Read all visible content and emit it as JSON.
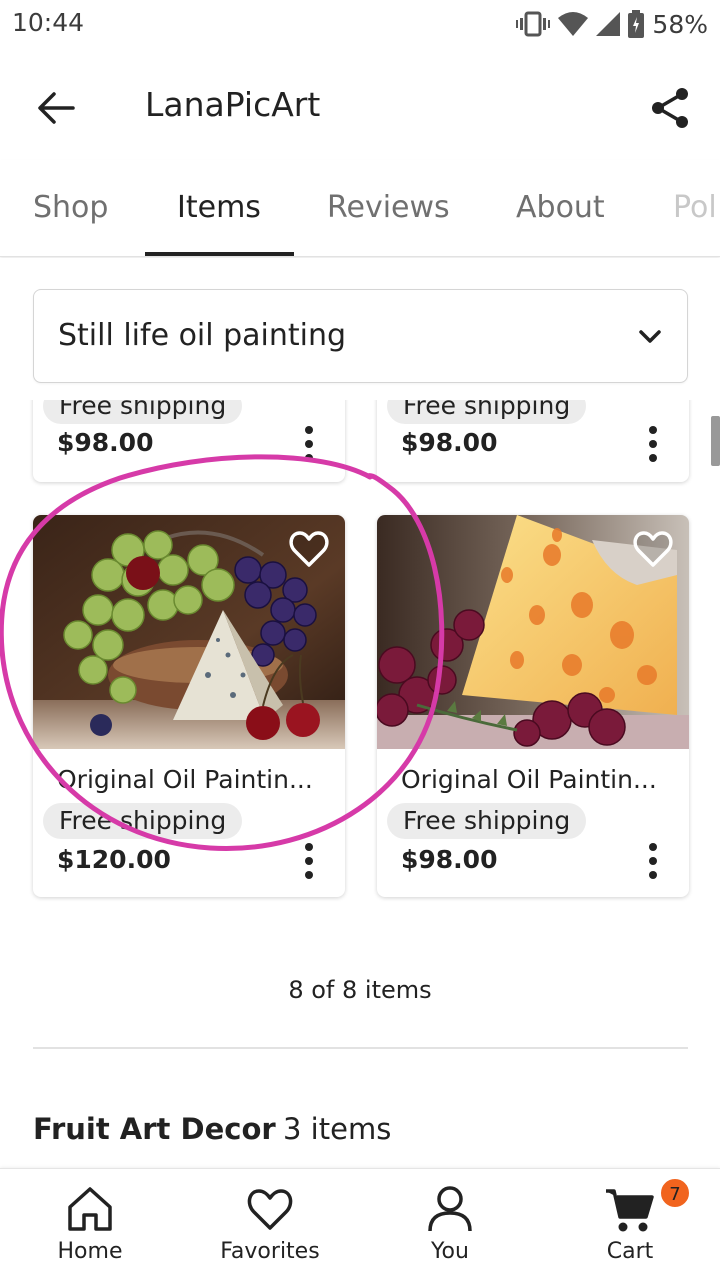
{
  "status_bar": {
    "time": "10:44",
    "battery": "58%"
  },
  "app_bar": {
    "title": "LanaPicArt"
  },
  "tabs": [
    {
      "label": "Shop",
      "active": false
    },
    {
      "label": "Items",
      "active": true
    },
    {
      "label": "Reviews",
      "active": false
    },
    {
      "label": "About",
      "active": false
    },
    {
      "label": "Pol",
      "active": false
    }
  ],
  "section_select": {
    "value": "Still life oil painting"
  },
  "partial_cards": [
    {
      "shipping": "Free shipping",
      "price": "$98.00"
    },
    {
      "shipping": "Free shipping",
      "price": "$98.00"
    }
  ],
  "cards": [
    {
      "title": "Original Oil Paintin...",
      "shipping": "Free shipping",
      "price": "$120.00"
    },
    {
      "title": "Original Oil Paintin...",
      "shipping": "Free shipping",
      "price": "$98.00"
    }
  ],
  "item_count": "8 of 8 items",
  "next_section": {
    "title": "Fruit Art Decor",
    "count": "3 items"
  },
  "bottom_nav": [
    {
      "label": "Home",
      "icon": "home-icon"
    },
    {
      "label": "Favorites",
      "icon": "heart-icon"
    },
    {
      "label": "You",
      "icon": "person-icon"
    },
    {
      "label": "Cart",
      "icon": "cart-icon",
      "badge": "7"
    }
  ],
  "colors": {
    "accent_orange": "#f1641e",
    "annotation_pink": "#d63aa8",
    "text": "#222222"
  }
}
